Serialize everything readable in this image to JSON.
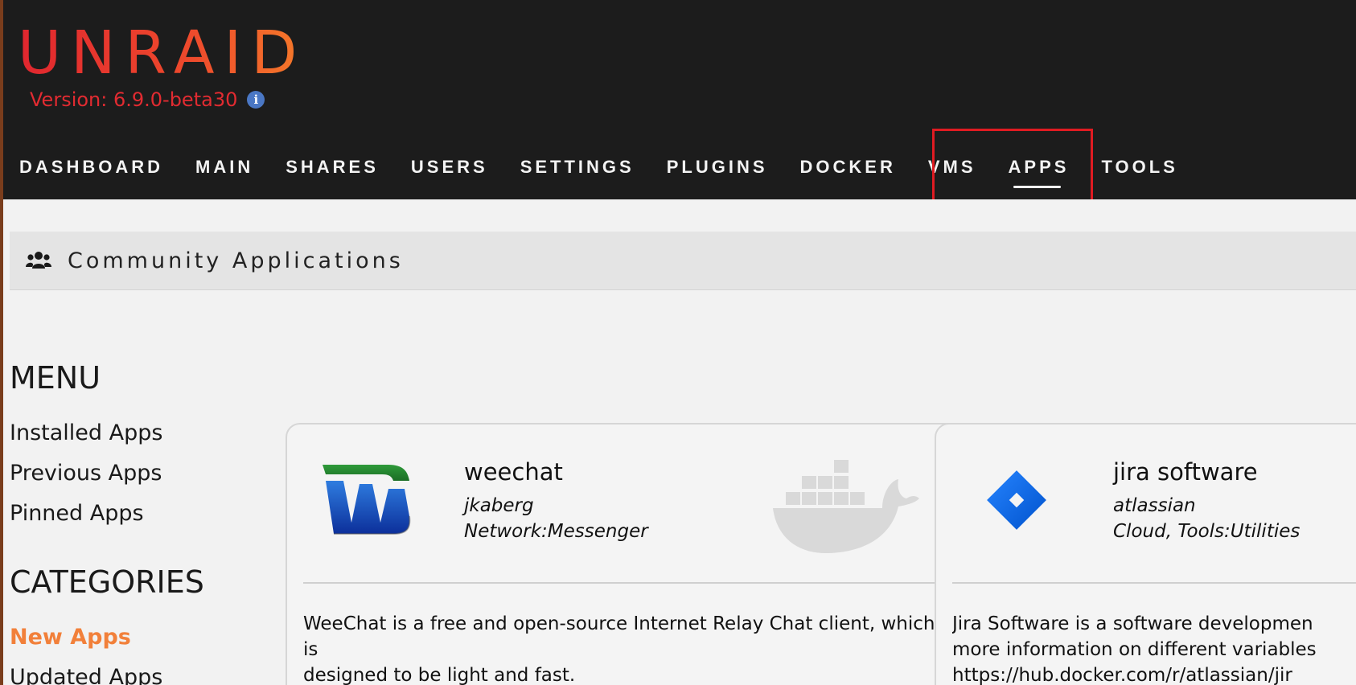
{
  "header": {
    "logo": "UNRAID",
    "version": "Version: 6.9.0-beta30",
    "version_info_icon": "info-icon",
    "nav": [
      {
        "label": "DASHBOARD",
        "name": "nav-dashboard",
        "active": false
      },
      {
        "label": "MAIN",
        "name": "nav-main",
        "active": false
      },
      {
        "label": "SHARES",
        "name": "nav-shares",
        "active": false
      },
      {
        "label": "USERS",
        "name": "nav-users",
        "active": false
      },
      {
        "label": "SETTINGS",
        "name": "nav-settings",
        "active": false
      },
      {
        "label": "PLUGINS",
        "name": "nav-plugins",
        "active": false
      },
      {
        "label": "DOCKER",
        "name": "nav-docker",
        "active": false
      },
      {
        "label": "VMS",
        "name": "nav-vms",
        "active": false
      },
      {
        "label": "APPS",
        "name": "nav-apps",
        "active": true
      },
      {
        "label": "TOOLS",
        "name": "nav-tools",
        "active": false
      }
    ]
  },
  "page": {
    "title": "Community Applications",
    "title_icon": "users-icon"
  },
  "sidebar": {
    "menu_heading": "MENU",
    "menu_items": [
      "Installed Apps",
      "Previous Apps",
      "Pinned Apps"
    ],
    "categories_heading": "CATEGORIES",
    "categories": [
      {
        "label": "New Apps",
        "active": true
      },
      {
        "label": "Updated Apps",
        "active": false
      }
    ]
  },
  "cards": [
    {
      "name": "weechat",
      "author": "jkaberg",
      "category": "Network:Messenger",
      "description": "WeeChat is a free and open-source Internet Relay Chat client, which is\ndesigned to be light and fast.",
      "icon": "weechat-logo",
      "badge_icon": "docker-icon"
    },
    {
      "name": "jira software",
      "author": "atlassian",
      "category": "Cloud, Tools:Utilities",
      "description": "Jira Software is a software developmen\nmore information on different variables\nhttps://hub.docker.com/r/atlassian/jir",
      "icon": "jira-logo"
    }
  ],
  "colors": {
    "header_bg": "#1c1c1c",
    "logo_start": "#e0262f",
    "logo_end": "#f57a2a",
    "accent_orange": "#f2803a",
    "highlight_red": "#e01b22",
    "info_blue": "#4a77c4",
    "content_bg": "#f2f2f2"
  }
}
